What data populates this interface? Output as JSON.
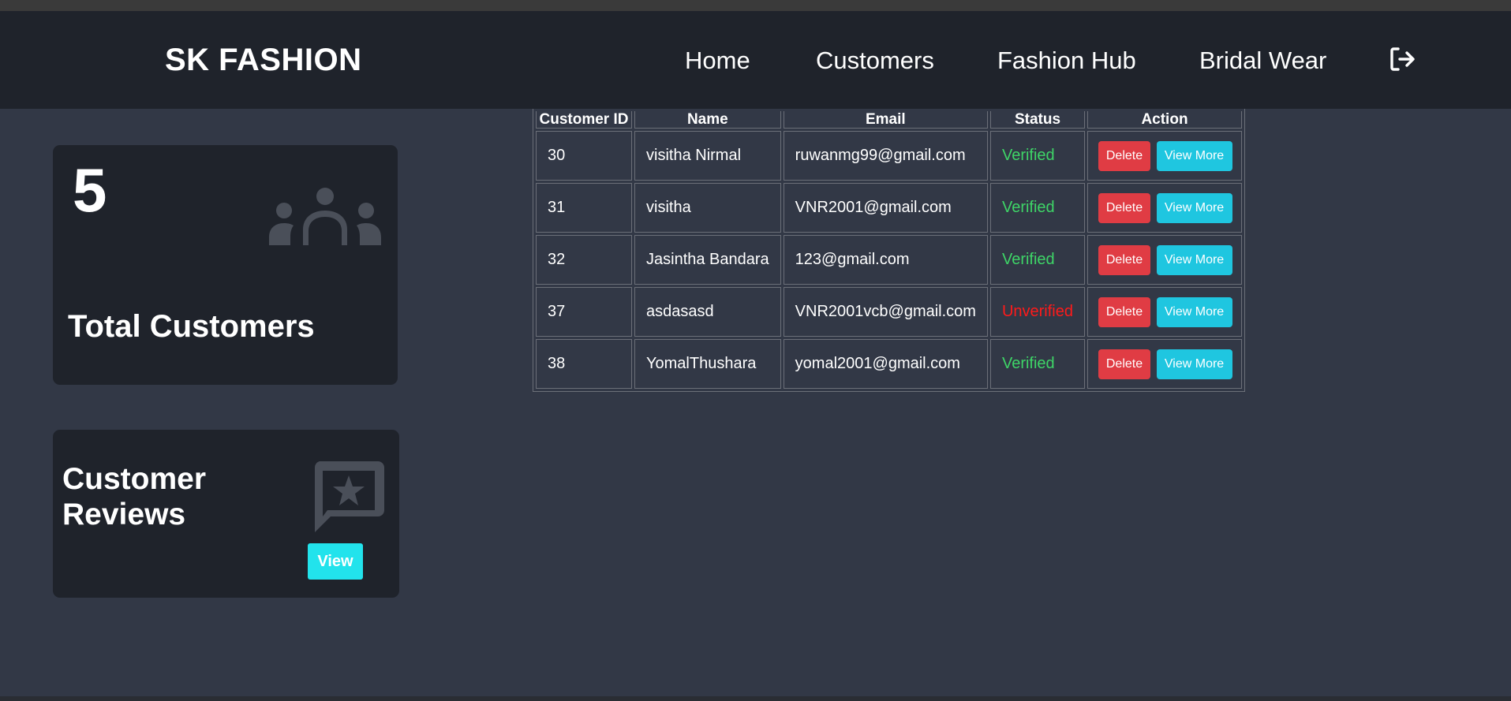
{
  "brand": "SK FASHION",
  "nav": {
    "items": [
      {
        "label": "Home"
      },
      {
        "label": "Customers"
      },
      {
        "label": "Fashion Hub"
      },
      {
        "label": "Bridal Wear"
      }
    ],
    "logout_icon": "logout-icon"
  },
  "stats": {
    "total_customers": {
      "value": "5",
      "label": "Total Customers",
      "icon": "group-icon"
    },
    "reviews": {
      "title": "Customer Reviews",
      "button": "View",
      "icon": "star-message-icon"
    }
  },
  "table": {
    "headers": [
      "Customer ID",
      "Name",
      "Email",
      "Status",
      "Action"
    ],
    "rows": [
      {
        "id": "30",
        "name": "visitha Nirmal",
        "email": "ruwanmg99@gmail.com",
        "status": "Verified",
        "delete": "Delete",
        "view": "View More"
      },
      {
        "id": "31",
        "name": "visitha",
        "email": "VNR2001@gmail.com",
        "status": "Verified",
        "delete": "Delete",
        "view": "View More"
      },
      {
        "id": "32",
        "name": "Jasintha Bandara",
        "email": "123@gmail.com",
        "status": "Verified",
        "delete": "Delete",
        "view": "View More"
      },
      {
        "id": "37",
        "name": "asdasasd",
        "email": "VNR2001vcb@gmail.com",
        "status": "Unverified",
        "delete": "Delete",
        "view": "View More"
      },
      {
        "id": "38",
        "name": "YomalThushara",
        "email": "yomal2001@gmail.com",
        "status": "Verified",
        "delete": "Delete",
        "view": "View More"
      }
    ]
  },
  "colors": {
    "background": "#323846",
    "navbar": "#1f232b",
    "card": "#1f232b",
    "verified": "#3ed567",
    "unverified": "#ff1a1a",
    "delete_button": "#e03c44",
    "view_more_button": "#1fc6e0",
    "view_button": "#22e3ec"
  }
}
